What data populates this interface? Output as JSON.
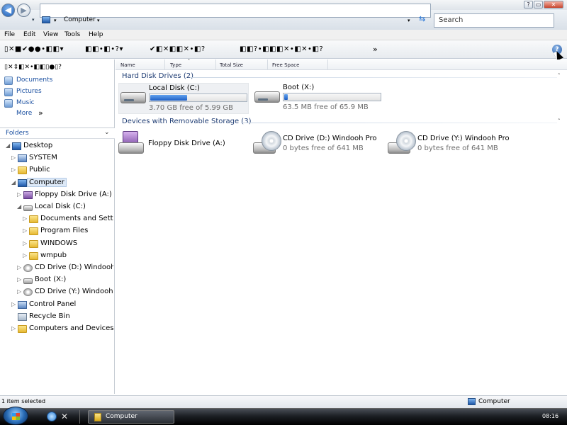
{
  "titlebar": {
    "buttons": [
      "?",
      "▭",
      "✕"
    ]
  },
  "address": {
    "path": "Computer",
    "separator": "▸",
    "dropdown": "▾",
    "refresh": "⇆"
  },
  "search": {
    "placeholder": "Search"
  },
  "menu": [
    "File",
    "Edit",
    "View",
    "Tools",
    "Help"
  ],
  "toolbar": {
    "group1": "▯✕■✔●●•◧◧▾",
    "group2": "◧◧•◧•?▾",
    "group3": "✔◧✕◧◧✕•◧?",
    "group4": "◧◧?•◧◧◧✕•◧✕•◧?",
    "more": "»",
    "help": "?"
  },
  "leftpane": {
    "tools": "▯✕⇕◧✕•◧◧▯●▯?",
    "favorites": [
      "Documents",
      "Pictures",
      "Music"
    ],
    "more": "More",
    "more_arrows": "»",
    "folders_label": "Folders",
    "folders_caret": "⌄",
    "tree": [
      {
        "label": "Desktop",
        "exp": "◢",
        "icon": "monitor"
      },
      {
        "label": "SYSTEM",
        "exp": "▷",
        "icon": "cpanel"
      },
      {
        "label": "Public",
        "exp": "▷",
        "icon": "folder"
      },
      {
        "label": "Computer",
        "exp": "◢",
        "icon": "monitor"
      },
      {
        "label": "Floppy Disk Drive (A:)",
        "exp": "▷",
        "icon": "floppy"
      },
      {
        "label": "Local Disk (C:)",
        "exp": "◢",
        "icon": "drive"
      },
      {
        "label": "Documents and Settings",
        "exp": "▷",
        "icon": "folder"
      },
      {
        "label": "Program Files",
        "exp": "▷",
        "icon": "folder"
      },
      {
        "label": "WINDOWS",
        "exp": "▷",
        "icon": "folder"
      },
      {
        "label": "wmpub",
        "exp": "▷",
        "icon": "folder"
      },
      {
        "label": "CD Drive (D:) Windooh Pro",
        "exp": "▷",
        "icon": "cd"
      },
      {
        "label": "Boot (X:)",
        "exp": "▷",
        "icon": "drive"
      },
      {
        "label": "CD Drive (Y:) Windooh Pro",
        "exp": "▷",
        "icon": "cd"
      },
      {
        "label": "Control Panel",
        "exp": "▷",
        "icon": "cpanel"
      },
      {
        "label": "Recycle Bin",
        "exp": "",
        "icon": "bin"
      },
      {
        "label": "Computers and Devices",
        "exp": "▷",
        "icon": "folder"
      }
    ]
  },
  "columns": [
    "Name",
    "Type",
    "Total Size",
    "Free Space"
  ],
  "groups": {
    "hdd": {
      "title": "Hard Disk Drives (2)",
      "caret": "˄"
    },
    "removable": {
      "title": "Devices with Removable Storage (3)",
      "caret": "˄"
    }
  },
  "drives": {
    "c": {
      "name": "Local Disk (C:)",
      "free": "3.70  GB free of 5.99  GB",
      "used_fraction": 0.38
    },
    "x": {
      "name": "Boot (X:)",
      "free": "63.5  MB free of 65.9  MB",
      "used_fraction": 0.04
    },
    "a": {
      "name": "Floppy Disk Drive (A:)"
    },
    "d": {
      "name": "CD Drive (D:) Windooh Pro",
      "free": "0  bytes free of 641  MB"
    },
    "y": {
      "name": "CD Drive (Y:) Windooh Pro",
      "free": "0  bytes free of 641  MB"
    }
  },
  "status": {
    "selection": "1 item selected",
    "location": "Computer"
  },
  "taskbar": {
    "task": "Computer",
    "clock": "08:16"
  },
  "colors": {
    "accent": "#1d5ec4",
    "link": "#1a4fa0",
    "group_header": "#1e3c73"
  }
}
